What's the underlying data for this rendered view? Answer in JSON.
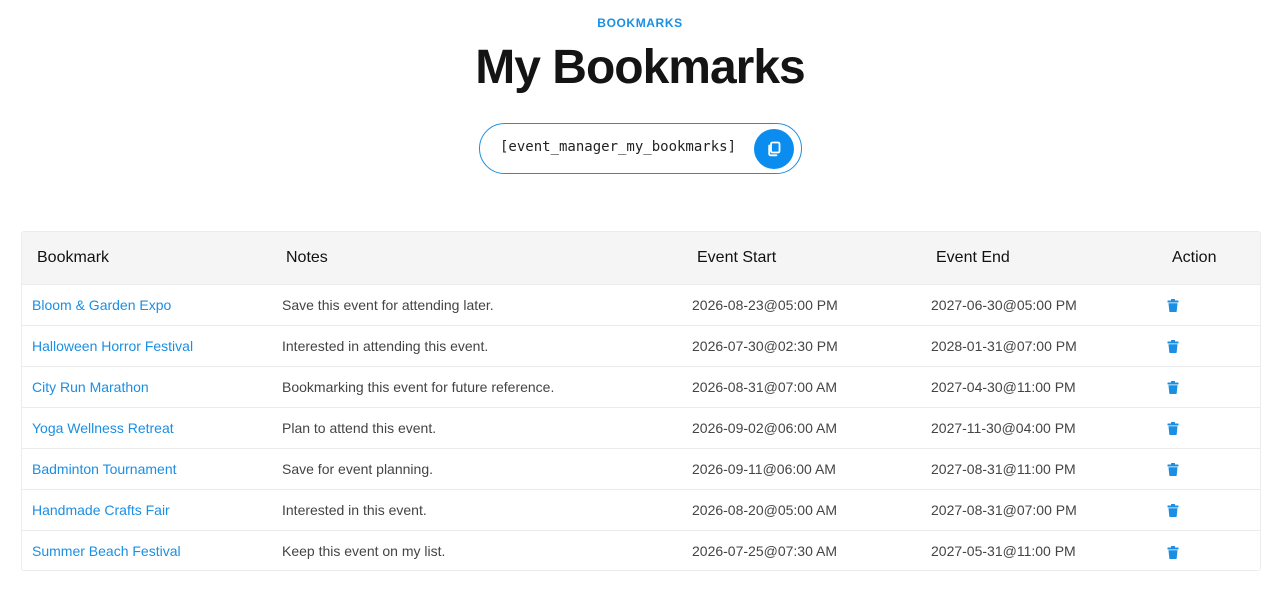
{
  "header": {
    "eyebrow": "BOOKMARKS",
    "title": "My Bookmarks"
  },
  "shortcode": {
    "text": "[event_manager_my_bookmarks]",
    "copy_icon": "copy-icon"
  },
  "table": {
    "columns": [
      "Bookmark",
      "Notes",
      "Event Start",
      "Event End",
      "Action"
    ],
    "rows": [
      {
        "title": "Bloom & Garden Expo",
        "notes": "Save this event for attending later.",
        "start": "2026-08-23@05:00 PM",
        "end": "2027-06-30@05:00 PM"
      },
      {
        "title": "Halloween Horror Festival",
        "notes": "Interested in attending this event.",
        "start": "2026-07-30@02:30 PM",
        "end": "2028-01-31@07:00 PM"
      },
      {
        "title": "City Run Marathon",
        "notes": "Bookmarking this event for future reference.",
        "start": "2026-08-31@07:00 AM",
        "end": "2027-04-30@11:00 PM"
      },
      {
        "title": "Yoga Wellness Retreat",
        "notes": "Plan to attend this event.",
        "start": "2026-09-02@06:00 AM",
        "end": "2027-11-30@04:00 PM"
      },
      {
        "title": "Badminton Tournament",
        "notes": "Save for event planning.",
        "start": "2026-09-11@06:00 AM",
        "end": "2027-08-31@11:00 PM"
      },
      {
        "title": "Handmade Crafts Fair",
        "notes": "Interested in this event.",
        "start": "2026-08-20@05:00 AM",
        "end": "2027-08-31@07:00 PM"
      },
      {
        "title": "Summer Beach Festival",
        "notes": "Keep this event on my list.",
        "start": "2026-07-25@07:30 AM",
        "end": "2027-05-31@11:00 PM"
      }
    ],
    "action_icon": "trash-icon"
  },
  "colors": {
    "accent": "#1a8fe3",
    "button": "#0b8df0",
    "header_bg": "#f5f5f5"
  }
}
